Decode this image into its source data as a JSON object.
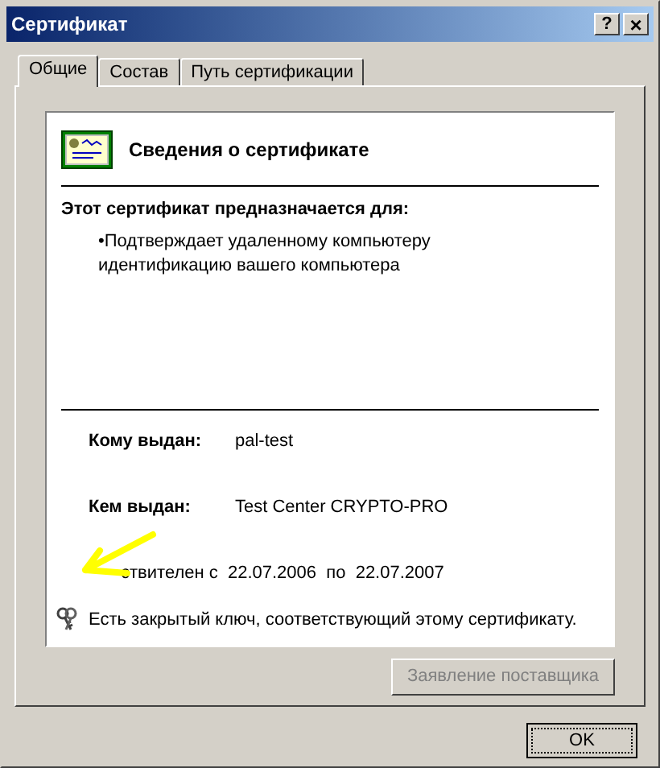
{
  "window": {
    "title": "Сертификат",
    "help_button": "?",
    "close_button": "×"
  },
  "tabs": [
    {
      "label": "Общие",
      "selected": true
    },
    {
      "label": "Состав",
      "selected": false
    },
    {
      "label": "Путь сертификации",
      "selected": false
    }
  ],
  "info": {
    "heading": "Сведения о сертификате",
    "purpose_title": "Этот сертификат предназначается для:",
    "purposes": [
      {
        "bullet": "•",
        "text": "Подтверждает удаленному компьютеру идентификацию вашего компьютера"
      }
    ],
    "fields": [
      {
        "label": "Кому выдан:",
        "value": "pal-test"
      },
      {
        "label": "Кем выдан:",
        "value": "Test Center CRYPTO-PRO"
      }
    ],
    "validity": {
      "from_label": "ствителен с",
      "from": "22.07.2006",
      "to_label": "по",
      "to": "22.07.2007"
    },
    "private_key_note": "Есть закрытый ключ, соответствующий этому сертификату."
  },
  "issuer_statement_button": {
    "label": "Заявление поставщика",
    "disabled": true
  },
  "ok_button": {
    "label": "OK"
  }
}
